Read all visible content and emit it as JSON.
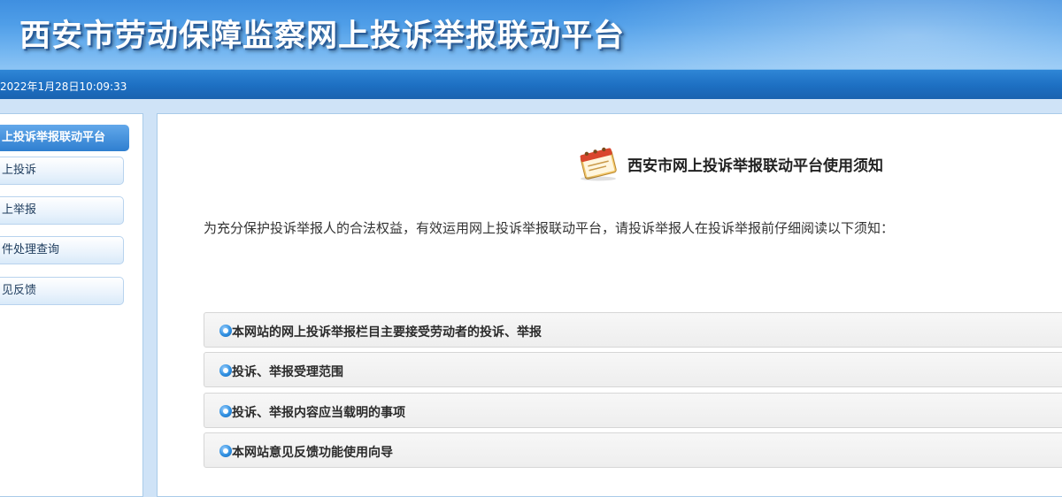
{
  "header": {
    "site_title": "西安市劳动保障监察网上投诉举报联动平台"
  },
  "datebar": {
    "datetime": "2022年1月28日10:09:33"
  },
  "sidebar": {
    "heading": "上投诉举报联动平台",
    "items": [
      {
        "label": "上投诉"
      },
      {
        "label": "上举报"
      },
      {
        "label": "件处理查询"
      },
      {
        "label": "见反馈"
      }
    ]
  },
  "main": {
    "notice_icon": "calendar-notepad-icon",
    "notice_title": "西安市网上投诉举报联动平台使用须知",
    "intro": "为充分保护投诉举报人的合法权益，有效运用网上投诉举报联动平台，请投诉举报人在投诉举报前仔细阅读以下须知：",
    "sections": [
      {
        "label": "本网站的网上投诉举报栏目主要接受劳动者的投诉、举报"
      },
      {
        "label": "投诉、举报受理范围"
      },
      {
        "label": "投诉、举报内容应当载明的事项"
      },
      {
        "label": "本网站意见反馈功能使用向导"
      }
    ]
  },
  "colors": {
    "banner_blue": "#4f9ee8",
    "datebar_blue": "#1d6fc2",
    "sidebar_head_blue": "#2f7fd0",
    "bullet_blue": "#2f8fe0"
  }
}
